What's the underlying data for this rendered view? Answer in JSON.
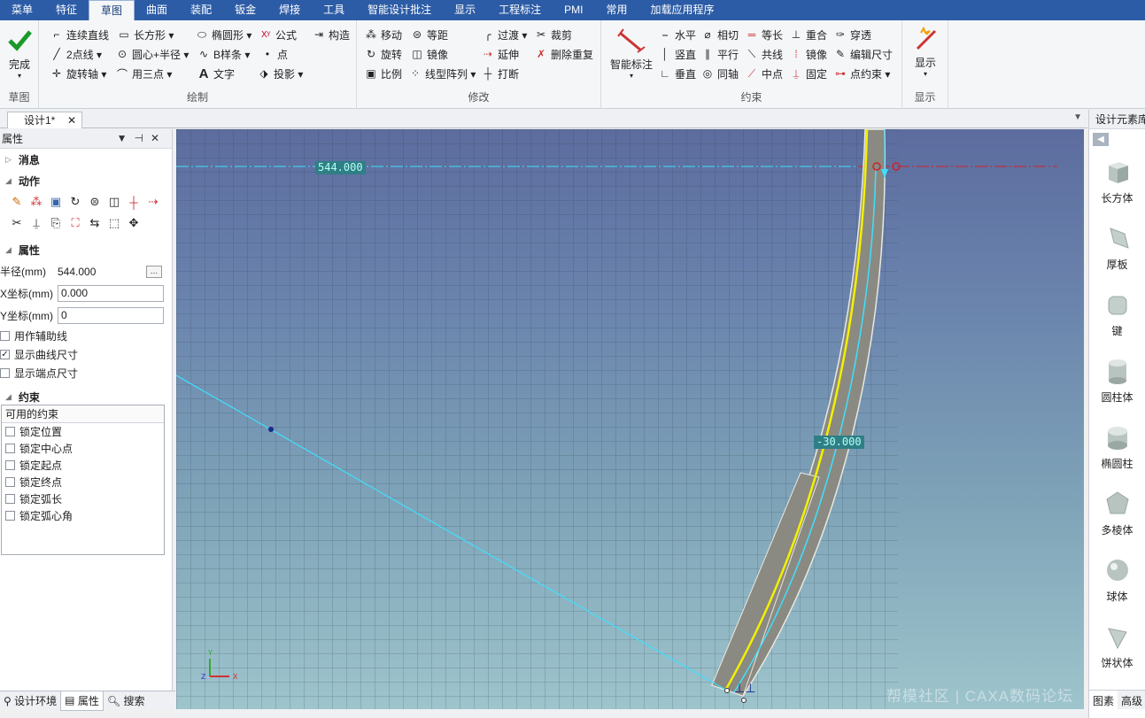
{
  "menu": [
    "菜单",
    "特征",
    "草图",
    "曲面",
    "装配",
    "钣金",
    "焊接",
    "工具",
    "智能设计批注",
    "显示",
    "工程标注",
    "PMI",
    "常用",
    "加载应用程序"
  ],
  "active_menu": "草图",
  "ribbon": {
    "complete": "完成",
    "group_sketch": "草图",
    "group_draw": "绘制",
    "group_modify": "修改",
    "group_constraint": "约束",
    "group_display": "显示",
    "draw": [
      "连续直线",
      "长方形 ▾",
      "椭圆形 ▾",
      "公式",
      "构造",
      "2点线 ▾",
      "圆心+半径 ▾",
      "B样条 ▾",
      "点",
      "旋转轴 ▾",
      "用三点 ▾",
      "文字",
      "投影 ▾"
    ],
    "modify": [
      "移动",
      "等距",
      "过渡 ▾",
      "裁剪",
      "旋转",
      "镜像",
      "延伸",
      "删除重复",
      "比例",
      "线型阵列 ▾",
      "打断"
    ],
    "smart_dim": "智能标注",
    "constraint": [
      "水平",
      "相切",
      "等长",
      "重合",
      "穿透",
      "竖直",
      "平行",
      "共线",
      "镜像",
      "编辑尺寸",
      "垂直",
      "同轴",
      "中点",
      "固定",
      "点约束 ▾"
    ],
    "display": "显示"
  },
  "doc_tab": "设计1*",
  "left_panel": {
    "title": "属性",
    "sec_message": "消息",
    "sec_action": "动作",
    "sec_props": "属性",
    "radius_label": "半径(mm)",
    "radius_value": "544.000",
    "x_label": "X坐标(mm)",
    "x_value": "0.000",
    "y_label": "Y坐标(mm)",
    "y_value": "0",
    "opt_aux": "用作辅助线",
    "opt_curve_dim": "显示曲线尺寸",
    "opt_end_dim": "显示端点尺寸",
    "sec_constraint": "约束",
    "avail": "可用的约束",
    "constraints": [
      "锁定位置",
      "锁定中心点",
      "锁定起点",
      "锁定终点",
      "锁定弧长",
      "锁定弧心角"
    ]
  },
  "bottom_tabs": [
    "设计环境",
    "属性",
    "搜索"
  ],
  "canvas": {
    "dim_radius": "544.000",
    "dim_offset": "-30.000",
    "watermark": "帮模社区 | CAXA数码论坛"
  },
  "right_panel": {
    "title": "设计元素库",
    "items": [
      "长方体",
      "厚板",
      "键",
      "圆柱体",
      "椭圆柱",
      "多棱体",
      "球体",
      "饼状体"
    ],
    "tabs": [
      "图素",
      "高级"
    ]
  }
}
